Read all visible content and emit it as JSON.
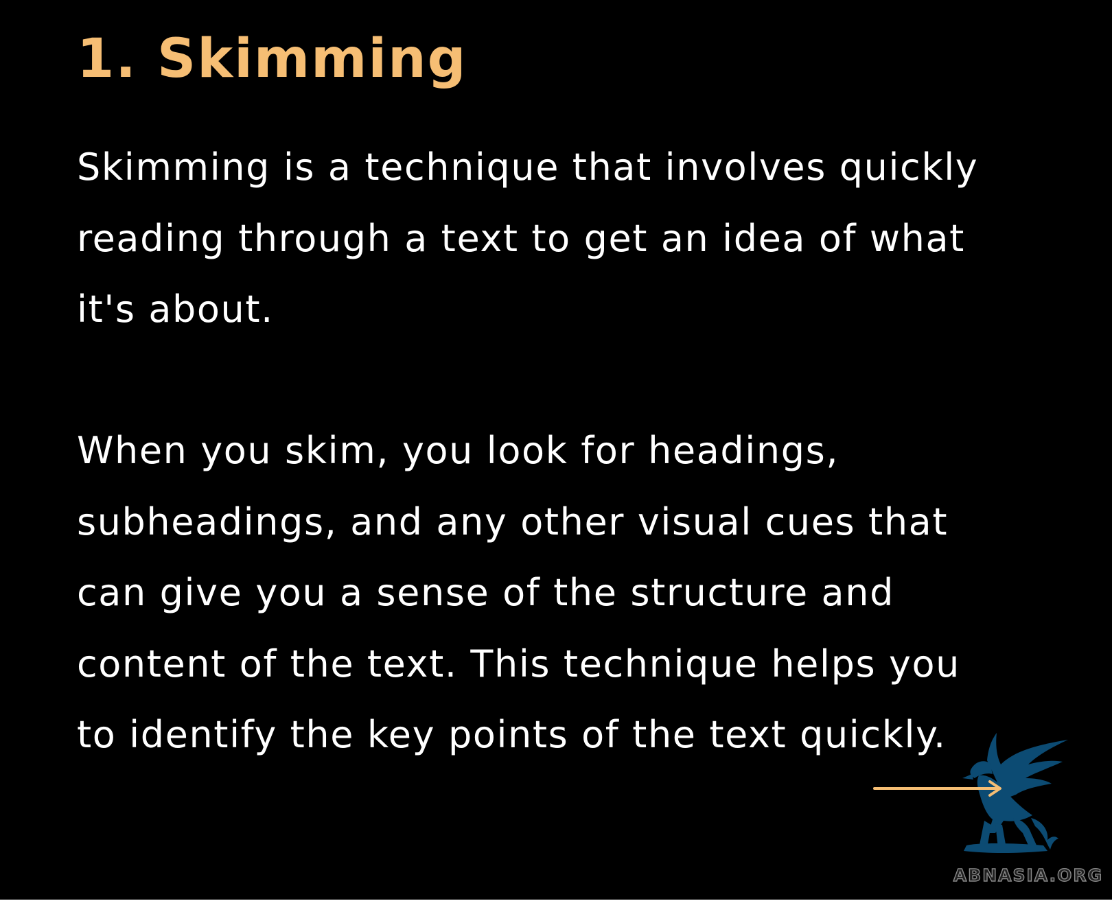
{
  "slide": {
    "heading": "1. Skimming",
    "paragraph1_lines": [
      "Skimming is a technique that involves quickly",
      "reading through a text to get an idea of what",
      "it's about."
    ],
    "paragraph2_lines": [
      "When you skim, you look for headings,",
      "subheadings, and any other visual cues that",
      "can give you a sense of the structure and",
      "content of the text. This technique helps you",
      "to identify the key points of the text quickly."
    ],
    "next_icon": "arrow-right-icon"
  },
  "watermark": {
    "text": "ABNASIA.ORG",
    "icon": "griffin-logo"
  },
  "colors": {
    "background": "#000000",
    "heading": "#f6be74",
    "body_text": "#ffffff",
    "arrow": "#f6be74",
    "logo": "#0c4b73"
  }
}
